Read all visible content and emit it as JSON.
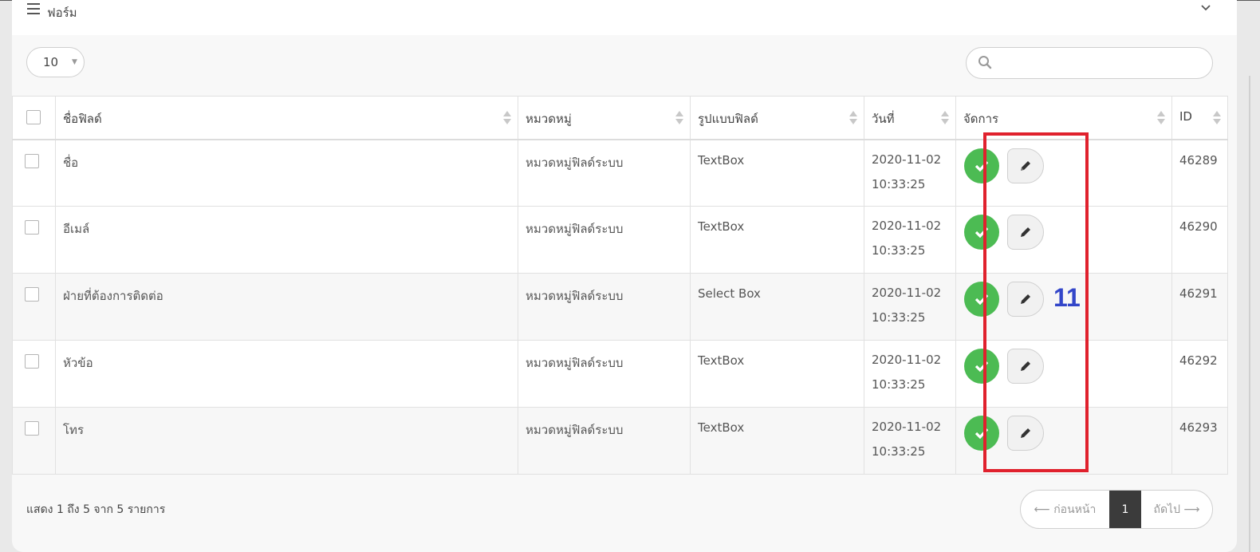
{
  "panel": {
    "title": "ฟอร์ม"
  },
  "length": {
    "value": "10"
  },
  "search": {
    "placeholder": ""
  },
  "table": {
    "headers": [
      "ชื่อฟิลด์",
      "หมวดหมู่",
      "รูปแบบฟิลด์",
      "วันที่",
      "จัดการ",
      "ID"
    ],
    "rows": [
      {
        "name": "ชื่อ",
        "category": "หมวดหมู่ฟิลด์ระบบ",
        "type": "TextBox",
        "date": "2020-11-02",
        "time": "10:33:25",
        "id": "46289"
      },
      {
        "name": "อีเมล์",
        "category": "หมวดหมู่ฟิลด์ระบบ",
        "type": "TextBox",
        "date": "2020-11-02",
        "time": "10:33:25",
        "id": "46290"
      },
      {
        "name": "ฝ่ายที่ต้องการติดต่อ",
        "category": "หมวดหมู่ฟิลด์ระบบ",
        "type": "Select Box",
        "date": "2020-11-02",
        "time": "10:33:25",
        "id": "46291"
      },
      {
        "name": "หัวข้อ",
        "category": "หมวดหมู่ฟิลด์ระบบ",
        "type": "TextBox",
        "date": "2020-11-02",
        "time": "10:33:25",
        "id": "46292"
      },
      {
        "name": "โทร",
        "category": "หมวดหมู่ฟิลด์ระบบ",
        "type": "TextBox",
        "date": "2020-11-02",
        "time": "10:33:25",
        "id": "46293"
      }
    ]
  },
  "annotation": {
    "label": "11",
    "color": "#e0212d"
  },
  "footer": {
    "info": "แสดง 1 ถึง 5 จาก 5 รายการ",
    "prev": "⟵ ก่อนหน้า",
    "page": "1",
    "next": "ถัดไป ⟶"
  },
  "colors": {
    "success": "#4cbb53",
    "active_page": "#3b3b3b",
    "annotation_text": "#3346c9"
  }
}
